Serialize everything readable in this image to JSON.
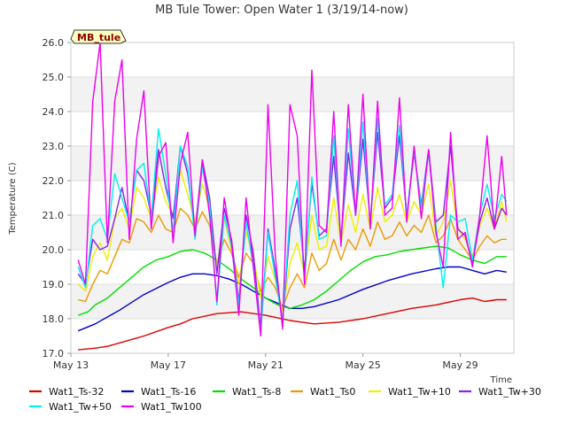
{
  "chart_data": {
    "type": "line",
    "title": "MB Tule Tower: Open Water 1 (3/19/14-now)",
    "xlabel": "Time",
    "ylabel": "Temperature (C)",
    "station_label": "MB_tule",
    "xlim": [
      13.0,
      31.2
    ],
    "ylim": [
      17.0,
      26.0
    ],
    "x_ticks": [
      {
        "value": 13,
        "label": "May 13"
      },
      {
        "value": 17,
        "label": "May 17"
      },
      {
        "value": 21,
        "label": "May 21"
      },
      {
        "value": 25,
        "label": "May 25"
      },
      {
        "value": 29,
        "label": "May 29"
      }
    ],
    "y_ticks": [
      17.0,
      18.0,
      19.0,
      20.0,
      21.0,
      22.0,
      23.0,
      24.0,
      25.0,
      26.0
    ],
    "y_tick_labels": [
      "17.0",
      "18.0",
      "19.0",
      "20.0",
      "21.0",
      "22.0",
      "23.0",
      "24.0",
      "25.0",
      "26.0"
    ],
    "grid": "horizontal",
    "legend_position": "bottom",
    "series": [
      {
        "name": "Wat1_Ts-32",
        "color": "#dd0000",
        "x": [
          13.3,
          14,
          14.5,
          15,
          16,
          17,
          17.5,
          18,
          19,
          20,
          21,
          22,
          23,
          24,
          25,
          26,
          27,
          28,
          29,
          29.5,
          30,
          30.5,
          30.9
        ],
        "y": [
          17.1,
          17.15,
          17.2,
          17.3,
          17.5,
          17.75,
          17.85,
          18.0,
          18.15,
          18.2,
          18.1,
          17.95,
          17.85,
          17.9,
          18.0,
          18.15,
          18.3,
          18.4,
          18.55,
          18.6,
          18.5,
          18.55,
          18.55
        ]
      },
      {
        "name": "Wat1_Ts-16",
        "color": "#0000cc",
        "x": [
          13.3,
          14,
          15,
          16,
          17,
          17.5,
          18,
          18.5,
          19,
          19.5,
          20,
          20.5,
          21,
          21.5,
          22,
          22.5,
          23,
          24,
          25,
          26,
          27,
          28,
          28.5,
          29,
          29.5,
          30,
          30.5,
          30.9
        ],
        "y": [
          17.65,
          17.85,
          18.25,
          18.7,
          19.05,
          19.2,
          19.3,
          19.3,
          19.25,
          19.15,
          19.0,
          18.8,
          18.6,
          18.45,
          18.3,
          18.3,
          18.35,
          18.55,
          18.85,
          19.1,
          19.3,
          19.45,
          19.5,
          19.5,
          19.4,
          19.3,
          19.4,
          19.35
        ]
      },
      {
        "name": "Wat1_Ts-8",
        "color": "#00dd00",
        "x": [
          13.3,
          13.7,
          14,
          14.5,
          15,
          15.5,
          16,
          16.5,
          17,
          17.5,
          18,
          18.5,
          19,
          19.5,
          20,
          20.5,
          21,
          21.5,
          22,
          22.5,
          23,
          23.5,
          24,
          24.5,
          25,
          25.5,
          26,
          26.5,
          27,
          27.5,
          28,
          28.5,
          29,
          29.5,
          30,
          30.5,
          30.9
        ],
        "y": [
          18.1,
          18.2,
          18.4,
          18.6,
          18.9,
          19.2,
          19.5,
          19.7,
          19.8,
          19.95,
          20.0,
          19.9,
          19.7,
          19.45,
          19.15,
          18.9,
          18.6,
          18.4,
          18.3,
          18.4,
          18.55,
          18.8,
          19.1,
          19.4,
          19.65,
          19.8,
          19.85,
          19.95,
          20.0,
          20.05,
          20.1,
          20.05,
          19.85,
          19.7,
          19.6,
          19.8,
          19.8
        ]
      },
      {
        "name": "Wat1_Ts0",
        "color": "#ee9900",
        "x": [
          13.3,
          13.6,
          13.9,
          14.2,
          14.5,
          14.8,
          15.1,
          15.4,
          15.7,
          16,
          16.3,
          16.6,
          16.9,
          17.2,
          17.5,
          17.8,
          18.1,
          18.4,
          18.7,
          19,
          19.3,
          19.6,
          19.9,
          20.2,
          20.5,
          20.8,
          21.1,
          21.4,
          21.7,
          22,
          22.3,
          22.6,
          22.9,
          23.2,
          23.5,
          23.8,
          24.1,
          24.4,
          24.7,
          25,
          25.3,
          25.6,
          25.9,
          26.2,
          26.5,
          26.8,
          27.1,
          27.4,
          27.7,
          28,
          28.3,
          28.6,
          28.9,
          29.2,
          29.5,
          29.8,
          30.1,
          30.4,
          30.7,
          30.9
        ],
        "y": [
          18.55,
          18.5,
          19.0,
          19.4,
          19.3,
          19.8,
          20.3,
          20.2,
          20.9,
          20.8,
          20.5,
          21.0,
          20.6,
          20.5,
          21.2,
          21.0,
          20.6,
          21.1,
          20.7,
          19.6,
          20.3,
          19.9,
          19.2,
          19.9,
          19.6,
          18.8,
          19.2,
          18.9,
          18.3,
          18.9,
          19.3,
          18.9,
          19.9,
          19.4,
          19.6,
          20.3,
          19.7,
          20.3,
          20.0,
          20.6,
          20.1,
          20.8,
          20.3,
          20.4,
          20.8,
          20.4,
          20.7,
          20.5,
          21.0,
          20.2,
          20.4,
          20.9,
          20.3,
          20.0,
          19.7,
          20.1,
          20.4,
          20.2,
          20.3,
          20.3
        ]
      },
      {
        "name": "Wat1_Tw+10",
        "color": "#eeee00",
        "x": [
          13.3,
          13.6,
          13.9,
          14.2,
          14.5,
          14.8,
          15.1,
          15.4,
          15.7,
          16,
          16.3,
          16.6,
          16.9,
          17.2,
          17.5,
          17.8,
          18.1,
          18.4,
          18.7,
          19,
          19.3,
          19.6,
          19.9,
          20.2,
          20.5,
          20.8,
          21.1,
          21.4,
          21.7,
          22,
          22.3,
          22.6,
          22.9,
          23.2,
          23.5,
          23.8,
          24.1,
          24.4,
          24.7,
          25,
          25.3,
          25.6,
          25.9,
          26.2,
          26.5,
          26.8,
          27.1,
          27.4,
          27.7,
          28,
          28.3,
          28.6,
          28.9,
          29.2,
          29.5,
          29.8,
          30.1,
          30.4,
          30.7,
          30.9
        ],
        "y": [
          19.0,
          18.8,
          19.8,
          20.2,
          19.7,
          20.9,
          21.2,
          20.6,
          21.8,
          21.5,
          20.9,
          22.1,
          21.4,
          21.0,
          22.3,
          21.6,
          20.8,
          21.9,
          21.2,
          19.5,
          20.9,
          20.0,
          19.0,
          20.5,
          19.8,
          18.6,
          19.8,
          19.1,
          18.2,
          19.6,
          20.2,
          19.3,
          21.0,
          20.0,
          20.1,
          21.5,
          20.2,
          21.3,
          20.5,
          21.6,
          20.6,
          21.8,
          20.8,
          21.0,
          21.6,
          20.8,
          21.4,
          21.0,
          21.9,
          20.4,
          20.8,
          22.0,
          20.6,
          20.3,
          19.8,
          20.7,
          21.2,
          20.6,
          21.4,
          20.8
        ]
      },
      {
        "name": "Wat1_Tw+30",
        "color": "#8822ee",
        "x": [
          13.3,
          13.6,
          13.9,
          14.2,
          14.5,
          14.8,
          15.1,
          15.4,
          15.7,
          16,
          16.3,
          16.6,
          16.9,
          17.2,
          17.5,
          17.8,
          18.1,
          18.4,
          18.7,
          19,
          19.3,
          19.6,
          19.9,
          20.2,
          20.5,
          20.8,
          21.1,
          21.4,
          21.7,
          22,
          22.3,
          22.6,
          22.9,
          23.2,
          23.5,
          23.8,
          24.1,
          24.4,
          24.7,
          25,
          25.3,
          25.6,
          25.9,
          26.2,
          26.5,
          26.8,
          27.1,
          27.4,
          27.7,
          28,
          28.3,
          28.6,
          28.9,
          29.2,
          29.5,
          29.8,
          30.1,
          30.4,
          30.7,
          30.9
        ],
        "y": [
          19.3,
          19.0,
          20.3,
          20.0,
          20.1,
          20.9,
          21.8,
          20.8,
          22.3,
          22.0,
          21.0,
          22.9,
          21.8,
          20.9,
          23.0,
          22.2,
          20.5,
          22.6,
          21.5,
          19.3,
          21.2,
          20.3,
          18.5,
          21.0,
          19.9,
          17.7,
          20.6,
          19.4,
          17.9,
          20.6,
          21.5,
          19.4,
          21.9,
          20.4,
          20.6,
          22.7,
          20.3,
          22.8,
          21.0,
          23.2,
          20.8,
          23.4,
          21.2,
          21.5,
          23.3,
          21.0,
          22.8,
          21.3,
          22.9,
          20.8,
          21.0,
          23.0,
          20.6,
          20.4,
          19.6,
          20.8,
          21.5,
          20.6,
          21.2,
          21.0
        ]
      },
      {
        "name": "Wat1_Tw+50",
        "color": "#00eeee",
        "x": [
          13.3,
          13.6,
          13.9,
          14.2,
          14.5,
          14.8,
          15.1,
          15.4,
          15.7,
          16,
          16.3,
          16.6,
          16.9,
          17.2,
          17.5,
          17.8,
          18.1,
          18.4,
          18.7,
          19,
          19.3,
          19.6,
          19.9,
          20.2,
          20.5,
          20.8,
          21.1,
          21.4,
          21.7,
          22,
          22.3,
          22.6,
          22.9,
          23.2,
          23.5,
          23.8,
          24.1,
          24.4,
          24.7,
          25,
          25.3,
          25.6,
          25.9,
          26.2,
          26.5,
          26.8,
          27.1,
          27.4,
          27.7,
          28,
          28.3,
          28.6,
          28.9,
          29.2,
          29.5,
          29.8,
          30.1,
          30.4,
          30.7,
          30.9
        ],
        "y": [
          19.5,
          18.9,
          20.7,
          20.9,
          20.3,
          22.2,
          21.5,
          20.8,
          22.3,
          22.5,
          20.9,
          23.5,
          22.2,
          20.5,
          23.0,
          22.4,
          20.3,
          22.4,
          21.3,
          18.4,
          21.0,
          20.1,
          18.4,
          20.8,
          19.5,
          17.6,
          20.5,
          19.2,
          17.9,
          21.0,
          22.0,
          19.1,
          22.1,
          20.3,
          20.4,
          23.3,
          20.2,
          23.5,
          21.0,
          23.7,
          20.7,
          23.8,
          21.3,
          21.6,
          23.6,
          21.0,
          22.9,
          21.2,
          22.8,
          20.7,
          18.9,
          21.0,
          20.8,
          20.9,
          19.7,
          21.0,
          21.9,
          20.9,
          21.6,
          21.4
        ]
      },
      {
        "name": "Wat1_Tw100",
        "color": "#ee00ee",
        "x": [
          13.3,
          13.6,
          13.9,
          14.2,
          14.5,
          14.8,
          15.1,
          15.4,
          15.7,
          16,
          16.3,
          16.6,
          16.9,
          17.2,
          17.5,
          17.8,
          18.1,
          18.4,
          18.7,
          19,
          19.3,
          19.6,
          19.9,
          20.2,
          20.5,
          20.8,
          21.1,
          21.4,
          21.7,
          22,
          22.3,
          22.6,
          22.9,
          23.2,
          23.5,
          23.8,
          24.1,
          24.4,
          24.7,
          25,
          25.3,
          25.6,
          25.9,
          26.2,
          26.5,
          26.8,
          27.1,
          27.4,
          27.7,
          28,
          28.3,
          28.6,
          28.9,
          29.2,
          29.5,
          29.8,
          30.1,
          30.4,
          30.7,
          30.9
        ],
        "y": [
          19.7,
          19.0,
          24.3,
          26.0,
          20.2,
          24.3,
          25.5,
          20.3,
          23.2,
          24.6,
          20.6,
          22.7,
          23.1,
          20.2,
          22.5,
          23.4,
          20.4,
          22.6,
          21.0,
          18.5,
          21.5,
          20.2,
          18.1,
          21.5,
          19.5,
          17.5,
          24.2,
          19.8,
          17.7,
          24.2,
          23.3,
          19.0,
          25.2,
          20.7,
          20.5,
          24.0,
          20.1,
          24.2,
          21.0,
          24.5,
          20.6,
          24.3,
          21.0,
          21.2,
          24.4,
          20.8,
          23.0,
          20.9,
          22.9,
          20.5,
          19.5,
          23.4,
          20.3,
          20.5,
          19.5,
          21.0,
          23.3,
          20.6,
          22.7,
          21.0
        ]
      }
    ]
  }
}
